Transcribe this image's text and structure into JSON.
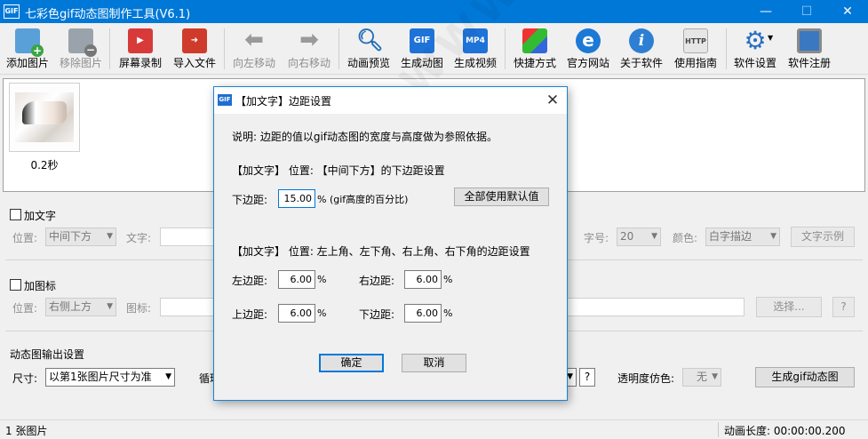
{
  "window": {
    "logo": "GIF",
    "title": "七彩色gif动态图制作工具(V6.1)",
    "minimize": "—",
    "maximize": "☐",
    "close": "✕"
  },
  "toolbar": {
    "add_image": "添加图片",
    "remove_image": "移除图片",
    "screen_record": "屏幕录制",
    "import_file": "导入文件",
    "move_left": "向左移动",
    "move_right": "向右移动",
    "preview": "动画预览",
    "gen_gif": "生成动图",
    "gen_video": "生成视频",
    "shortcuts": "快捷方式",
    "website": "官方网站",
    "about": "关于软件",
    "guide": "使用指南",
    "settings": "软件设置",
    "register": "软件注册",
    "gif_icon_text": "GIF",
    "mp4_icon_text": "MP4",
    "info_icon_text": "i",
    "web_icon_text": "e"
  },
  "thumbnail": {
    "caption": "0.2秒"
  },
  "text_section": {
    "checkbox_label": "加文字",
    "position_label": "位置:",
    "position_value": "中间下方",
    "text_label": "文字:",
    "size_label": "字号:",
    "size_value": "20",
    "color_label": "颜色:",
    "color_value": "白字描边",
    "example_button": "文字示例"
  },
  "icon_section": {
    "checkbox_label": "加图标",
    "position_label": "位置:",
    "position_value": "右侧上方",
    "icon_label": "图标:",
    "select_button": "选择...",
    "help_button": "?"
  },
  "output_section": {
    "title": "动态图输出设置",
    "size_label": "尺寸:",
    "size_value": "以第1张图片尺寸为准",
    "loop_label": "循环",
    "help_button": "?",
    "dither_label": "透明度仿色:",
    "dither_value": "无",
    "generate_button": "生成gif动态图"
  },
  "status": {
    "left": "1 张图片",
    "right": "动画长度: 00:00:00.200"
  },
  "watermark": "WWW.WEIDOWN.COM",
  "dialog": {
    "logo": "GIF",
    "title": "【加文字】边距设置",
    "close": "✕",
    "description": "说明: 边距的值以gif动态图的宽度与高度做为参照依据。",
    "section1_heading": "【加文字】 位置: 【中间下方】的下边距设置",
    "bottom_label": "下边距:",
    "bottom_value": "15.00",
    "bottom_suffix": "% (gif高度的百分比)",
    "use_default_button": "全部使用默认值",
    "section2_heading": "【加文字】 位置: 左上角、左下角、右上角、右下角的边距设置",
    "left_label": "左边距:",
    "left_value": "6.00",
    "right_label": "右边距:",
    "right_value": "6.00",
    "top_label": "上边距:",
    "top_value": "6.00",
    "bottom2_label": "下边距:",
    "bottom2_value": "6.00",
    "percent": "%",
    "ok_button": "确定",
    "cancel_button": "取消"
  }
}
